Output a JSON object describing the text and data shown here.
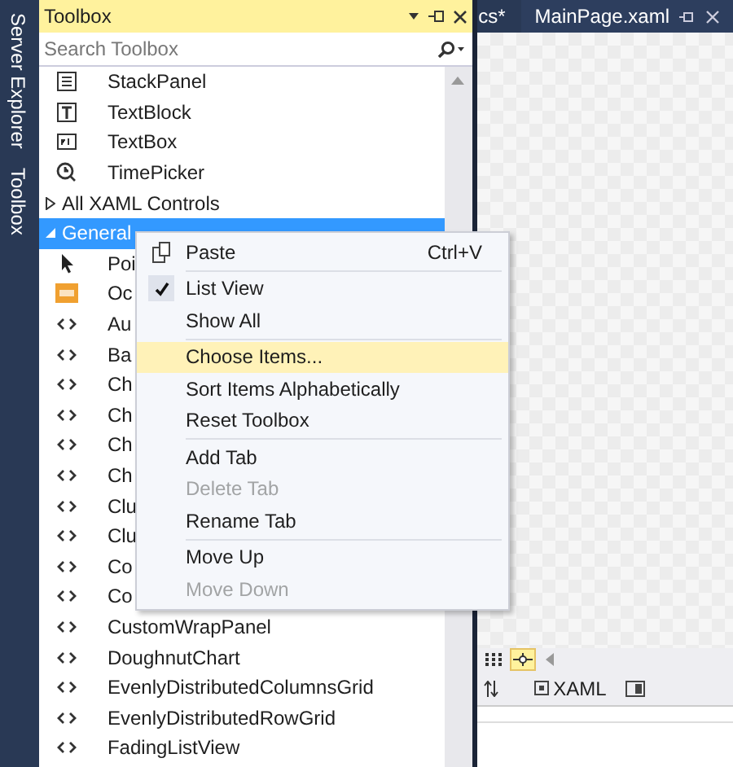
{
  "sidebar_tabs": [
    {
      "label": "Server Explorer"
    },
    {
      "label": "Toolbox"
    }
  ],
  "toolbox": {
    "title": "Toolbox",
    "search": {
      "placeholder": "Search Toolbox"
    },
    "top_items": [
      {
        "label": "StackPanel",
        "kind": "stackpanel"
      },
      {
        "label": "TextBlock",
        "kind": "textblock"
      },
      {
        "label": "TextBox",
        "kind": "textbox"
      },
      {
        "label": "TimePicker",
        "kind": "timepicker"
      }
    ],
    "groups": [
      {
        "label": "All XAML Controls",
        "expanded": false,
        "selected": false
      },
      {
        "label": "General",
        "expanded": true,
        "selected": true,
        "children": [
          {
            "label": "Poi",
            "kind": "pointer"
          },
          {
            "label": "Oc",
            "kind": "ocx"
          },
          {
            "label": "Au",
            "kind": "control"
          },
          {
            "label": "Ba",
            "kind": "control"
          },
          {
            "label": "Ch",
            "kind": "control"
          },
          {
            "label": "Ch",
            "kind": "control"
          },
          {
            "label": "Ch",
            "kind": "control"
          },
          {
            "label": "Ch",
            "kind": "control"
          },
          {
            "label": "Clu",
            "kind": "control"
          },
          {
            "label": "Clu",
            "kind": "control"
          },
          {
            "label": "Co",
            "kind": "control"
          },
          {
            "label": "Co",
            "kind": "control"
          },
          {
            "label": "CustomWrapPanel",
            "kind": "control"
          },
          {
            "label": "DoughnutChart",
            "kind": "control"
          },
          {
            "label": "EvenlyDistributedColumnsGrid",
            "kind": "control"
          },
          {
            "label": "EvenlyDistributedRowGrid",
            "kind": "control"
          },
          {
            "label": "FadingListView",
            "kind": "control"
          }
        ]
      }
    ]
  },
  "editor": {
    "tabs": [
      {
        "label": "cs*"
      },
      {
        "label": "MainPage.xaml"
      }
    ],
    "tools": [
      {
        "kind": "grid",
        "selected": false
      },
      {
        "kind": "crosshair",
        "selected": true
      }
    ],
    "pane_tab": "XAML"
  },
  "context_menu": {
    "sections": [
      [
        {
          "label": "Paste",
          "shortcut": "Ctrl+V",
          "kind": "paste",
          "checked": false,
          "disabled": false,
          "selected": false
        }
      ],
      [
        {
          "label": "List View",
          "checked": true,
          "disabled": false,
          "selected": false
        },
        {
          "label": "Show All",
          "checked": false,
          "disabled": false,
          "selected": false
        }
      ],
      [
        {
          "label": "Choose Items...",
          "checked": false,
          "disabled": false,
          "selected": true
        },
        {
          "label": "Sort Items Alphabetically",
          "checked": false,
          "disabled": false,
          "selected": false
        },
        {
          "label": "Reset Toolbox",
          "checked": false,
          "disabled": false,
          "selected": false
        }
      ],
      [
        {
          "label": "Add Tab",
          "checked": false,
          "disabled": false,
          "selected": false
        },
        {
          "label": "Delete Tab",
          "checked": false,
          "disabled": true,
          "selected": false
        },
        {
          "label": "Rename Tab",
          "checked": false,
          "disabled": false,
          "selected": false
        }
      ],
      [
        {
          "label": "Move Up",
          "checked": false,
          "disabled": false,
          "selected": false
        },
        {
          "label": "Move Down",
          "checked": false,
          "disabled": true,
          "selected": false
        }
      ]
    ]
  }
}
